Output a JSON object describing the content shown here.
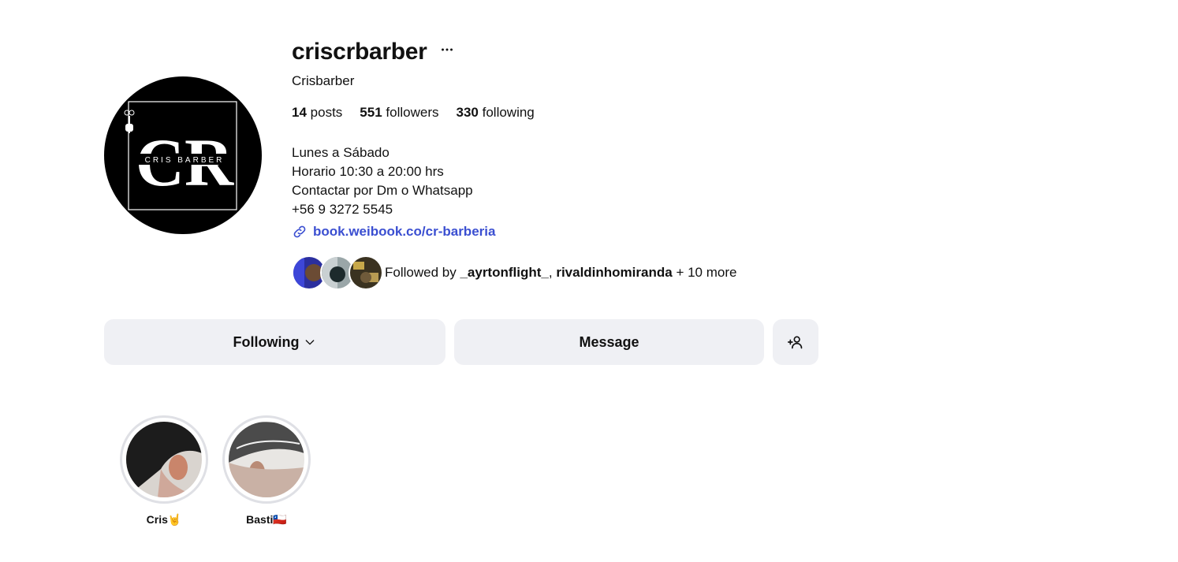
{
  "profile": {
    "username": "criscrbarber",
    "full_name": "Crisbarber",
    "avatar_text": {
      "monogram": "CR",
      "brand": "CRIS BARBER"
    }
  },
  "stats": {
    "posts_count": "14",
    "posts_label": "posts",
    "followers_count": "551",
    "followers_label": "followers",
    "following_count": "330",
    "following_label": "following"
  },
  "bio": {
    "lines": [
      "Lunes a Sábado",
      "Horario 10:30 a 20:00 hrs",
      "Contactar por Dm o Whatsapp",
      "+56 9 3272 5545"
    ],
    "link": "book.weibook.co/cr-barberia"
  },
  "followed_by": {
    "prefix": "Followed by",
    "user1": "_ayrtonflight_",
    "separator": ",",
    "user2": "rivaldinhomiranda",
    "suffix": "+ 10 more"
  },
  "actions": {
    "following_label": "Following",
    "message_label": "Message"
  },
  "highlights": [
    {
      "label": "Cris🤘"
    },
    {
      "label": "Basti🇨🇱"
    }
  ],
  "colors": {
    "link": "#3b4fd1",
    "button_bg": "#eff0f4",
    "ring": "#dfe0e5"
  },
  "icons": [
    "more-options-icon",
    "link-icon",
    "chevron-down-icon",
    "add-person-icon"
  ]
}
